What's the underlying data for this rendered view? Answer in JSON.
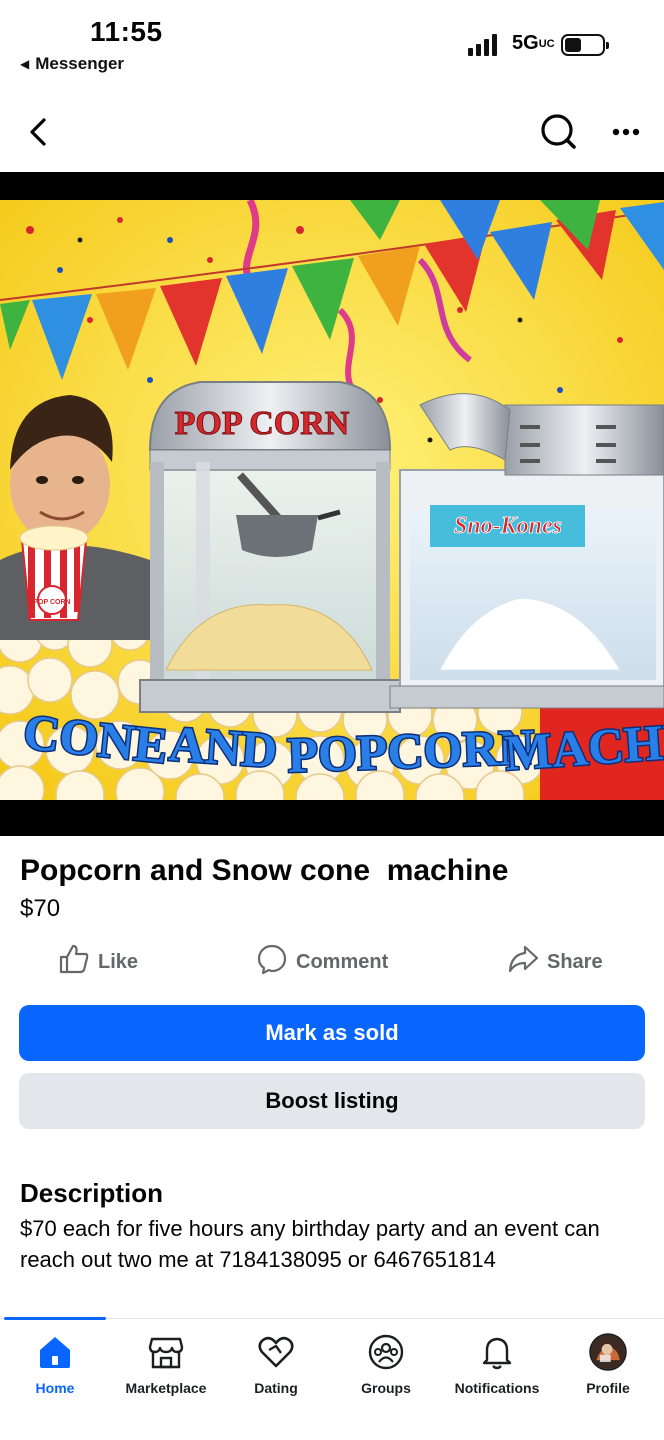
{
  "status_bar": {
    "time": "11:55",
    "back_app": "Messenger",
    "network": "5G",
    "network_sub": "UC",
    "battery_percent": 45
  },
  "nav": {
    "back_icon": "chevron-left-icon",
    "search_icon": "search-icon",
    "more_icon": "more-dots-icon"
  },
  "hero": {
    "popcorn_sign": "POP CORN",
    "bag_text": "POP CORN",
    "sno_sign": "Sno-Kones",
    "banner_words": [
      "CONE",
      "AND",
      "POPCORN",
      "MACHI"
    ]
  },
  "listing": {
    "title": "Popcorn and Snow cone  machine",
    "price": "$70",
    "actions": [
      {
        "label": "Like",
        "icon": "thumbs-up-icon"
      },
      {
        "label": "Comment",
        "icon": "comment-icon"
      },
      {
        "label": "Share",
        "icon": "share-icon"
      }
    ],
    "primary_button": "Mark as sold",
    "secondary_button": "Boost listing",
    "description_heading": "Description",
    "description": "$70 each for five hours any birthday party and an event can reach out two me at 7184138095 or 6467651814"
  },
  "tabbar": {
    "tabs": [
      {
        "label": "Home",
        "icon": "home-icon",
        "active": true
      },
      {
        "label": "Marketplace",
        "icon": "marketplace-icon",
        "active": false
      },
      {
        "label": "Dating",
        "icon": "dating-heart-icon",
        "active": false
      },
      {
        "label": "Groups",
        "icon": "groups-icon",
        "active": false
      },
      {
        "label": "Notifications",
        "icon": "bell-icon",
        "active": false
      },
      {
        "label": "Profile",
        "icon": "profile-avatar",
        "active": false
      }
    ]
  },
  "colors": {
    "accent": "#0866ff",
    "secondary_button": "#e4e6eb",
    "muted_text": "#65676b",
    "hero_background": "#f7d53a"
  }
}
